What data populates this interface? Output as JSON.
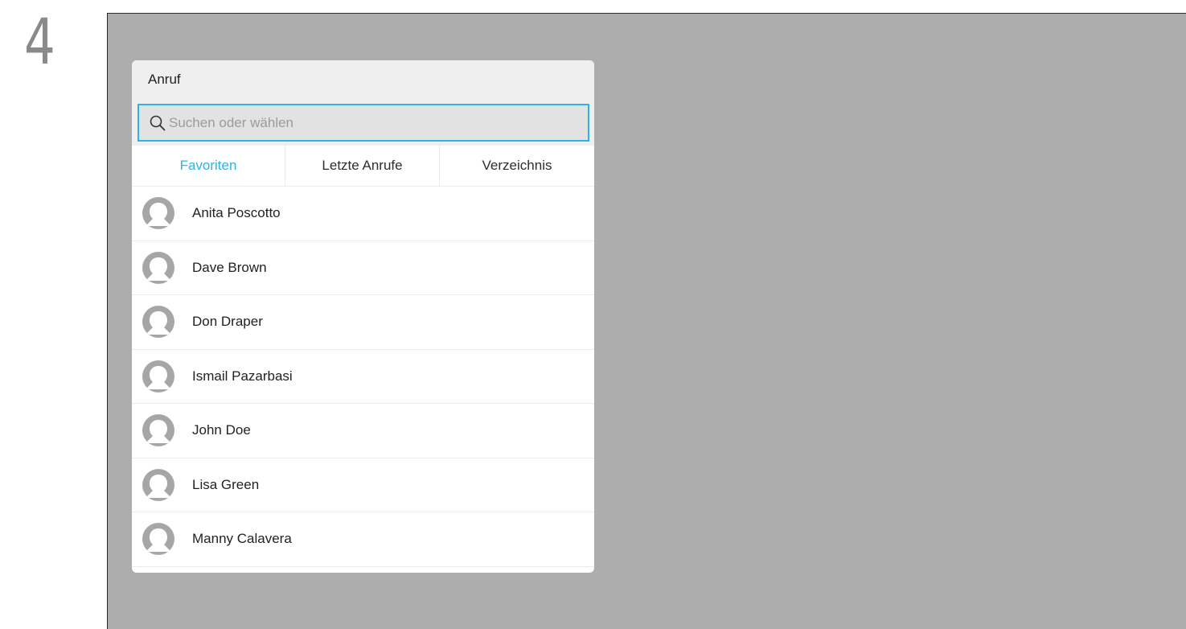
{
  "step": {
    "number": "4"
  },
  "dialog": {
    "title": "Anruf",
    "search": {
      "placeholder": "Suchen oder wählen",
      "value": ""
    },
    "tabs": [
      {
        "label": "Favoriten",
        "active": true
      },
      {
        "label": "Letzte Anrufe",
        "active": false
      },
      {
        "label": "Verzeichnis",
        "active": false
      }
    ],
    "contacts": [
      {
        "name": "Anita Poscotto"
      },
      {
        "name": "Dave Brown"
      },
      {
        "name": "Don Draper"
      },
      {
        "name": "Ismail Pazarbasi"
      },
      {
        "name": "John Doe"
      },
      {
        "name": "Lisa Green"
      },
      {
        "name": "Manny Calavera"
      }
    ]
  },
  "colors": {
    "accent": "#2eb3e6",
    "screen_background": "#adadad",
    "avatar": "#a6a6a6"
  },
  "icons": {
    "search": "search-icon",
    "avatar": "person-icon"
  }
}
